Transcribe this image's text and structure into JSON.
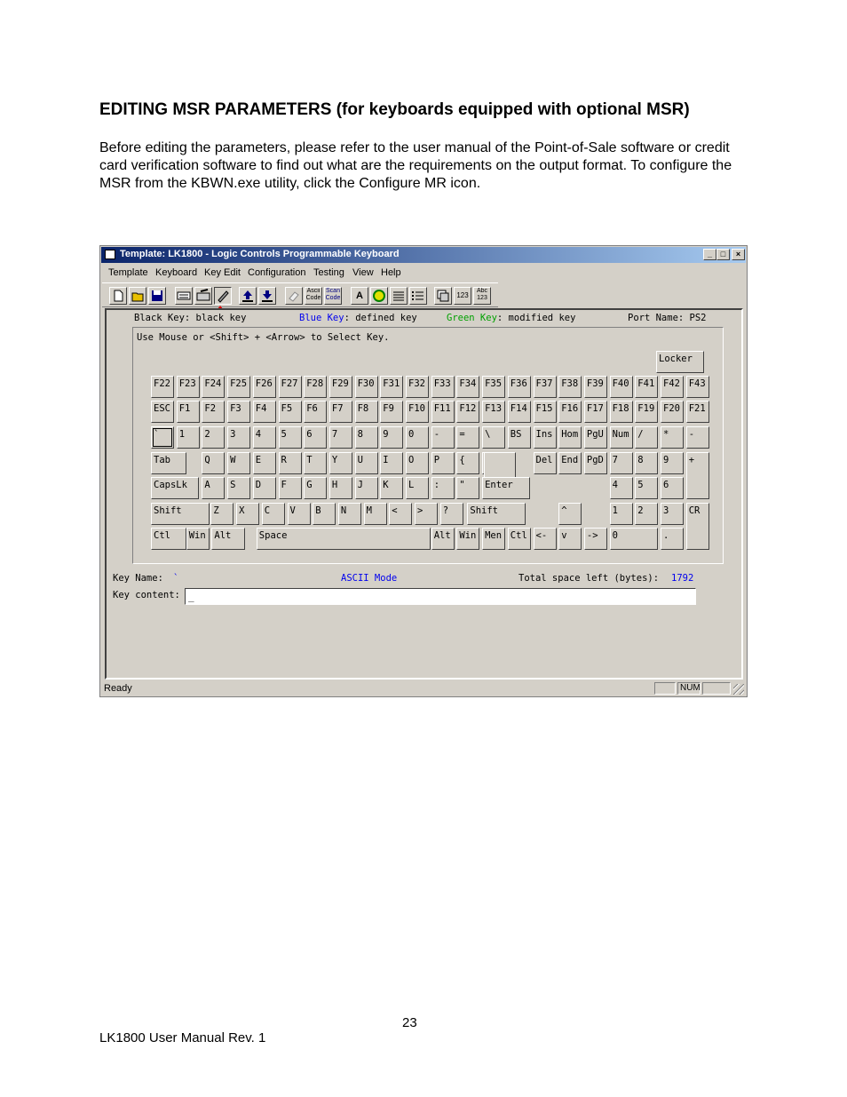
{
  "heading": "EDITING MSR PARAMETERS (for keyboards equipped with optional MSR)",
  "paragraph": "Before editing the parameters, please refer to the user manual of the Point-of-Sale software or credit card verification software to find out what are the requirements on the output format. To configure the MSR from the KBWN.exe utility, click the Configure MR icon.",
  "window": {
    "title": "Template: LK1800 - Logic Controls Programmable Keyboard",
    "controls": {
      "minimize": "_",
      "maximize": "□",
      "close": "×"
    },
    "menu": [
      "Template",
      "Keyboard",
      "Key Edit",
      "Configuration",
      "Testing",
      "View",
      "Help"
    ],
    "toolbar": [
      {
        "name": "new-file-icon",
        "label": ""
      },
      {
        "name": "open-folder-icon",
        "label": ""
      },
      {
        "name": "save-disk-icon",
        "label": ""
      },
      {
        "name": "keyboard-grid-icon",
        "label": ""
      },
      {
        "name": "keyboard-edit-icon",
        "label": ""
      },
      {
        "name": "configure-mr-icon",
        "label": ""
      },
      {
        "name": "upload-icon",
        "label": ""
      },
      {
        "name": "download-icon",
        "label": ""
      },
      {
        "name": "eraser-icon",
        "label": ""
      },
      {
        "name": "ascii-code-icon",
        "label": "Ascii Code"
      },
      {
        "name": "scan-code-icon",
        "label": "Scan Code"
      },
      {
        "name": "font-icon",
        "label": "A"
      },
      {
        "name": "test-icon",
        "label": ""
      },
      {
        "name": "list-icon",
        "label": ""
      },
      {
        "name": "list-numbered-icon",
        "label": ""
      },
      {
        "name": "copy-icon",
        "label": ""
      },
      {
        "name": "number-icon",
        "label": "123"
      },
      {
        "name": "abc-icon",
        "label": "Abc 123"
      }
    ],
    "legend": {
      "black_label": "Black Key",
      "black_text": ": black key",
      "blue_label": "Blue Key",
      "blue_text": ": defined key",
      "green_label": "Green Key",
      "green_text": ": modified key",
      "port": "Port Name: PS2"
    },
    "instruction": "Use Mouse or <Shift> + <Arrow> to Select Key.",
    "keys": {
      "row_locker": [
        "Locker"
      ],
      "row_f": [
        "F22",
        "F23",
        "F24",
        "F25",
        "F26",
        "F27",
        "F28",
        "F29",
        "F30",
        "F31",
        "F32",
        "F33",
        "F34",
        "F35",
        "F36",
        "F37",
        "F38",
        "F39",
        "F40",
        "F41",
        "F42",
        "F43"
      ],
      "row_fn": [
        "ESC",
        "F1",
        "F2",
        "F3",
        "F4",
        "F5",
        "F6",
        "F7",
        "F8",
        "F9",
        "F10",
        "F11",
        "F12",
        "F13",
        "F14",
        "F15",
        "F16",
        "F17",
        "F18",
        "F19",
        "F20",
        "F21"
      ],
      "row_num": [
        "`",
        "1",
        "2",
        "3",
        "4",
        "5",
        "6",
        "7",
        "8",
        "9",
        "0",
        "-",
        "=",
        "\\",
        "BS",
        "Ins",
        "Hom",
        "PgU",
        "Num",
        "/",
        "*",
        "-"
      ],
      "row_tab": [
        "Tab",
        "Q",
        "W",
        "E",
        "R",
        "T",
        "Y",
        "U",
        "I",
        "O",
        "P",
        "{",
        "}",
        "",
        "Del",
        "End",
        "PgD",
        "7",
        "8",
        "9",
        "+"
      ],
      "row_caps": [
        "CapsLk",
        "A",
        "S",
        "D",
        "F",
        "G",
        "H",
        "J",
        "K",
        "L",
        ":",
        "\"",
        "Enter",
        "4",
        "5",
        "6"
      ],
      "row_shift": [
        "Shift",
        "Z",
        "X",
        "C",
        "V",
        "B",
        "N",
        "M",
        "<",
        ">",
        "?",
        "Shift",
        "^",
        "1",
        "2",
        "3",
        "CR"
      ],
      "row_ctl": [
        "Ctl",
        "Win",
        "Alt",
        "Space",
        "Alt",
        "Win",
        "Men",
        "Ctl",
        "<-",
        "v",
        "->",
        "0",
        "."
      ]
    },
    "info": {
      "key_name_label": "Key Name:",
      "key_name_value": "`",
      "mode": "ASCII Mode",
      "space_label": "Total space left (bytes):",
      "space_value": "1792",
      "key_content_label": "Key content:",
      "key_content_value": "_"
    },
    "status": {
      "ready": "Ready",
      "num": "NUM"
    }
  },
  "page_number": "23",
  "footer": "LK1800 User Manual Rev. 1"
}
